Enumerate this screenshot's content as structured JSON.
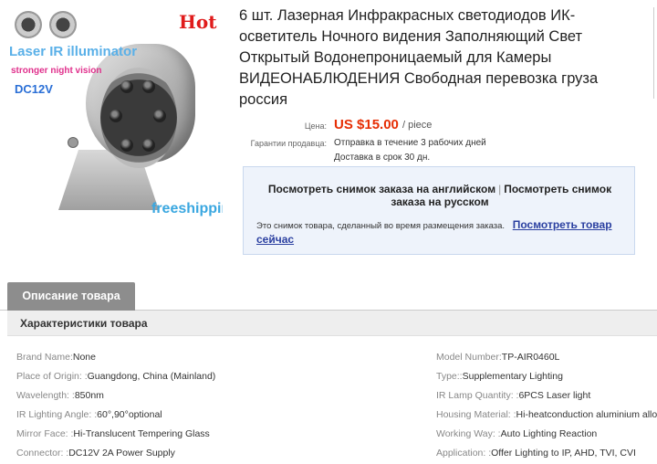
{
  "image": {
    "hot": "Hot",
    "line1": "Laser IR illuminator",
    "line2": "stronger night vision",
    "line3": "DC12V",
    "freeshipping": "freeshipping"
  },
  "title": "6 шт. Лазерная Инфракрасных светодиодов ИК-осветитель Ночного видения Заполняющий Свет Открытый Водонепроницаемый для Камеры ВИДЕОНАБЛЮДЕНИЯ Свободная перевозка груза россия",
  "price": {
    "label": "Цена:",
    "value": "US $15.00",
    "unit": "/ piece"
  },
  "guarantee": {
    "label": "Гарантии продавца:",
    "line1": "Отправка в течение 3 рабочих дней",
    "line2": "Доставка в срок 30 дн."
  },
  "snapshot": {
    "english_link": "Посмотреть снимок заказа на английском",
    "separator": "|",
    "russian_link": "Посмотреть снимок заказа на русском",
    "note": "Это снимок товара, сделанный во время размещения заказа.",
    "view_now": "Посмотреть товар сейчас"
  },
  "tabs": {
    "description": "Описание товара"
  },
  "specs_title": "Характеристики товара",
  "specs_left": [
    {
      "key": "Brand Name:",
      "value": "None"
    },
    {
      "key": "Place of Origin: :",
      "value": "Guangdong, China (Mainland)"
    },
    {
      "key": "Wavelength: :",
      "value": "850nm"
    },
    {
      "key": "IR Lighting Angle: :",
      "value": "60°,90°optional"
    },
    {
      "key": "Mirror Face: :",
      "value": "Hi-Translucent Tempering Glass"
    },
    {
      "key": "Connector: :",
      "value": "DC12V 2A Power Supply"
    }
  ],
  "specs_right": [
    {
      "key": "Model Number:",
      "value": "TP-AIR0460L"
    },
    {
      "key": "Type::",
      "value": "Supplementary Lighting"
    },
    {
      "key": "IR Lamp Quantity: :",
      "value": "6PCS Laser light"
    },
    {
      "key": "Housing Material: :",
      "value": "Hi-heatconduction aluminium alloy"
    },
    {
      "key": "Working Way: :",
      "value": "Auto Lighting Reaction"
    },
    {
      "key": "Application: :",
      "value": "Offer Lighting to IP, AHD, TVI, CVI"
    }
  ],
  "colors": {
    "price": "#e62e04",
    "link": "#2a3fa0",
    "tab": "#8d8d8d",
    "snapshot_bg": "#eef3fb"
  }
}
